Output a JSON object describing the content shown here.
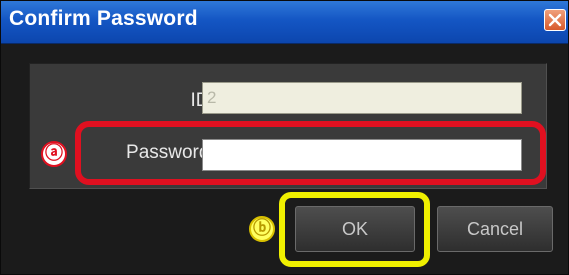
{
  "window": {
    "title": "Confirm Password",
    "close_icon": "close-icon"
  },
  "form": {
    "id_label": "ID :",
    "id_value": "2",
    "password_label": "Password :",
    "password_value": ""
  },
  "buttons": {
    "ok_label": "OK",
    "cancel_label": "Cancel"
  },
  "annotations": {
    "marker_a": "ⓐ",
    "marker_b": "ⓑ",
    "highlight_a_color": "#e01020",
    "highlight_b_color": "#f0f000"
  }
}
